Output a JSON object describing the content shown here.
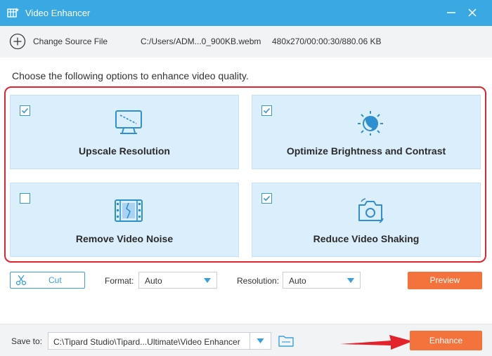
{
  "window": {
    "title": "Video Enhancer",
    "icons": [
      "app-icon",
      "minimize-icon",
      "close-icon"
    ]
  },
  "source": {
    "change_label": "Change Source File",
    "file_path": "C:/Users/ADM...0_900KB.webm",
    "file_info": "480x270/00:00:30/880.06 KB"
  },
  "instructions": "Choose the following options to enhance video quality.",
  "options": [
    {
      "label": "Upscale Resolution",
      "checked": true,
      "icon": "monitor-icon"
    },
    {
      "label": "Optimize Brightness and Contrast",
      "checked": true,
      "icon": "brightness-icon"
    },
    {
      "label": "Remove Video Noise",
      "checked": false,
      "icon": "film-noise-icon"
    },
    {
      "label": "Reduce Video Shaking",
      "checked": true,
      "icon": "camera-stabilize-icon"
    }
  ],
  "controls": {
    "cut_label": "Cut",
    "format_label": "Format:",
    "format_value": "Auto",
    "resolution_label": "Resolution:",
    "resolution_value": "Auto",
    "preview_label": "Preview"
  },
  "bottom": {
    "save_label": "Save to:",
    "save_path": "C:\\Tipard Studio\\Tipard...Ultimate\\Video Enhancer",
    "enhance_label": "Enhance"
  },
  "colors": {
    "titlebar": "#3aa8e3",
    "accent": "#f4723c",
    "option_bg": "#dbeefb",
    "highlight": "#e02430",
    "arrow": "#e3222b"
  }
}
